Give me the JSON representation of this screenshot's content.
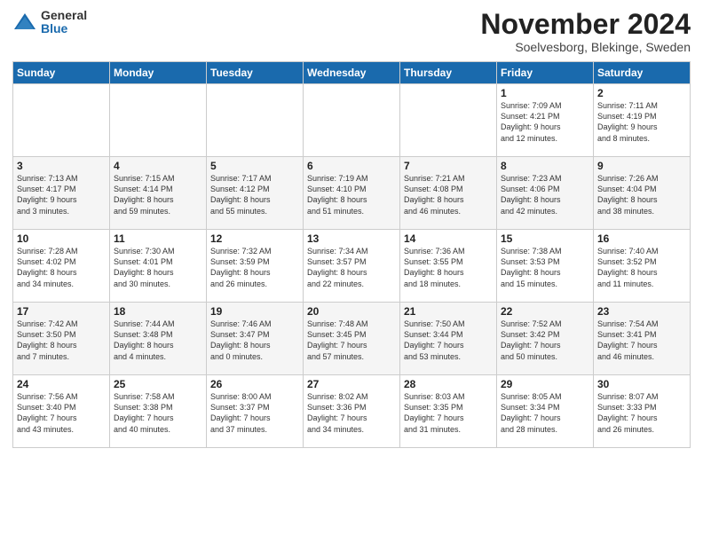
{
  "logo": {
    "general": "General",
    "blue": "Blue"
  },
  "title": "November 2024",
  "subtitle": "Soelvesborg, Blekinge, Sweden",
  "days_header": [
    "Sunday",
    "Monday",
    "Tuesday",
    "Wednesday",
    "Thursday",
    "Friday",
    "Saturday"
  ],
  "weeks": [
    [
      {
        "day": "",
        "info": ""
      },
      {
        "day": "",
        "info": ""
      },
      {
        "day": "",
        "info": ""
      },
      {
        "day": "",
        "info": ""
      },
      {
        "day": "",
        "info": ""
      },
      {
        "day": "1",
        "info": "Sunrise: 7:09 AM\nSunset: 4:21 PM\nDaylight: 9 hours\nand 12 minutes."
      },
      {
        "day": "2",
        "info": "Sunrise: 7:11 AM\nSunset: 4:19 PM\nDaylight: 9 hours\nand 8 minutes."
      }
    ],
    [
      {
        "day": "3",
        "info": "Sunrise: 7:13 AM\nSunset: 4:17 PM\nDaylight: 9 hours\nand 3 minutes."
      },
      {
        "day": "4",
        "info": "Sunrise: 7:15 AM\nSunset: 4:14 PM\nDaylight: 8 hours\nand 59 minutes."
      },
      {
        "day": "5",
        "info": "Sunrise: 7:17 AM\nSunset: 4:12 PM\nDaylight: 8 hours\nand 55 minutes."
      },
      {
        "day": "6",
        "info": "Sunrise: 7:19 AM\nSunset: 4:10 PM\nDaylight: 8 hours\nand 51 minutes."
      },
      {
        "day": "7",
        "info": "Sunrise: 7:21 AM\nSunset: 4:08 PM\nDaylight: 8 hours\nand 46 minutes."
      },
      {
        "day": "8",
        "info": "Sunrise: 7:23 AM\nSunset: 4:06 PM\nDaylight: 8 hours\nand 42 minutes."
      },
      {
        "day": "9",
        "info": "Sunrise: 7:26 AM\nSunset: 4:04 PM\nDaylight: 8 hours\nand 38 minutes."
      }
    ],
    [
      {
        "day": "10",
        "info": "Sunrise: 7:28 AM\nSunset: 4:02 PM\nDaylight: 8 hours\nand 34 minutes."
      },
      {
        "day": "11",
        "info": "Sunrise: 7:30 AM\nSunset: 4:01 PM\nDaylight: 8 hours\nand 30 minutes."
      },
      {
        "day": "12",
        "info": "Sunrise: 7:32 AM\nSunset: 3:59 PM\nDaylight: 8 hours\nand 26 minutes."
      },
      {
        "day": "13",
        "info": "Sunrise: 7:34 AM\nSunset: 3:57 PM\nDaylight: 8 hours\nand 22 minutes."
      },
      {
        "day": "14",
        "info": "Sunrise: 7:36 AM\nSunset: 3:55 PM\nDaylight: 8 hours\nand 18 minutes."
      },
      {
        "day": "15",
        "info": "Sunrise: 7:38 AM\nSunset: 3:53 PM\nDaylight: 8 hours\nand 15 minutes."
      },
      {
        "day": "16",
        "info": "Sunrise: 7:40 AM\nSunset: 3:52 PM\nDaylight: 8 hours\nand 11 minutes."
      }
    ],
    [
      {
        "day": "17",
        "info": "Sunrise: 7:42 AM\nSunset: 3:50 PM\nDaylight: 8 hours\nand 7 minutes."
      },
      {
        "day": "18",
        "info": "Sunrise: 7:44 AM\nSunset: 3:48 PM\nDaylight: 8 hours\nand 4 minutes."
      },
      {
        "day": "19",
        "info": "Sunrise: 7:46 AM\nSunset: 3:47 PM\nDaylight: 8 hours\nand 0 minutes."
      },
      {
        "day": "20",
        "info": "Sunrise: 7:48 AM\nSunset: 3:45 PM\nDaylight: 7 hours\nand 57 minutes."
      },
      {
        "day": "21",
        "info": "Sunrise: 7:50 AM\nSunset: 3:44 PM\nDaylight: 7 hours\nand 53 minutes."
      },
      {
        "day": "22",
        "info": "Sunrise: 7:52 AM\nSunset: 3:42 PM\nDaylight: 7 hours\nand 50 minutes."
      },
      {
        "day": "23",
        "info": "Sunrise: 7:54 AM\nSunset: 3:41 PM\nDaylight: 7 hours\nand 46 minutes."
      }
    ],
    [
      {
        "day": "24",
        "info": "Sunrise: 7:56 AM\nSunset: 3:40 PM\nDaylight: 7 hours\nand 43 minutes."
      },
      {
        "day": "25",
        "info": "Sunrise: 7:58 AM\nSunset: 3:38 PM\nDaylight: 7 hours\nand 40 minutes."
      },
      {
        "day": "26",
        "info": "Sunrise: 8:00 AM\nSunset: 3:37 PM\nDaylight: 7 hours\nand 37 minutes."
      },
      {
        "day": "27",
        "info": "Sunrise: 8:02 AM\nSunset: 3:36 PM\nDaylight: 7 hours\nand 34 minutes."
      },
      {
        "day": "28",
        "info": "Sunrise: 8:03 AM\nSunset: 3:35 PM\nDaylight: 7 hours\nand 31 minutes."
      },
      {
        "day": "29",
        "info": "Sunrise: 8:05 AM\nSunset: 3:34 PM\nDaylight: 7 hours\nand 28 minutes."
      },
      {
        "day": "30",
        "info": "Sunrise: 8:07 AM\nSunset: 3:33 PM\nDaylight: 7 hours\nand 26 minutes."
      }
    ]
  ]
}
